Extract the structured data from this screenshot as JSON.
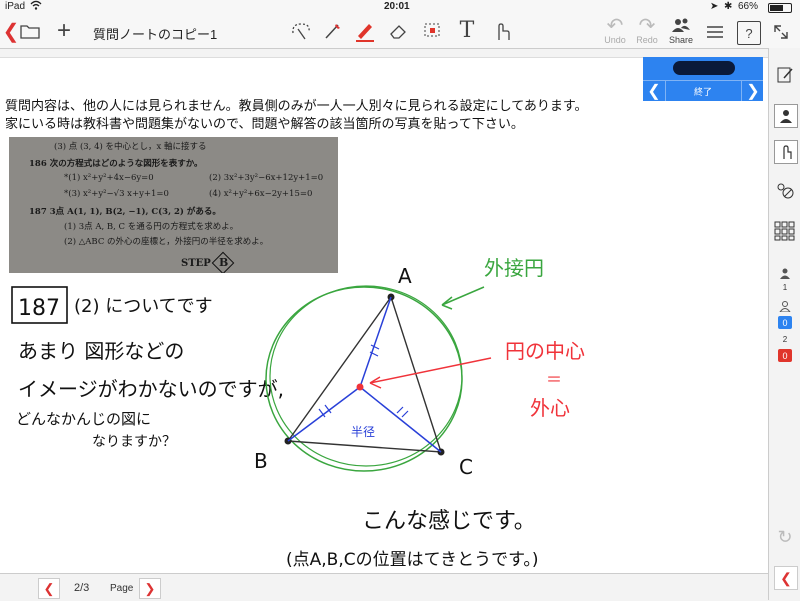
{
  "status_bar": {
    "device": "iPad",
    "time": "20:01",
    "battery": "66%"
  },
  "toolbar": {
    "title": "質問ノートのコピー1",
    "undo_label": "Undo",
    "redo_label": "Redo",
    "share_label": "Share",
    "help_label": "?"
  },
  "page": {
    "text_lines": [
      "質問内容は、他の人には見られません。教員側のみが一人一人別々に見られる設定にしてあります。",
      "家にいる時は教科書や問題集がないので、問題や解答の該当箇所の写真を貼って下さい。"
    ],
    "photo_lines": [
      "(3) 点 (3, 4) を中心とし，x 軸に接する",
      "186  次の方程式はどのような図形を表すか。",
      "*(1)  x²+y²+4x−6y=0",
      "(2)  3x²+3y²−6x+12y+1=0",
      "*(3)  x²+y²−√3 x+y+1=0",
      "(4)  x²+y²+6x−2y+15=0",
      "187  3点 A(1, 1), B(2, −1), C(3, 2) がある。",
      "(1)  3点 A, B, C を通る円の方程式を求めよ。",
      "(2)  △ABC の外心の座標と，外接円の半径を求めよ。",
      "STEP",
      "B"
    ],
    "handwriting": {
      "question_number": "187",
      "question_lines": [
        "(2) についてです",
        "あまり 図形などの",
        "イメージがわかないのですが,",
        "どんなかんじの図に",
        "なりますか？"
      ],
      "label_outer_circle": "外接円",
      "label_center_line1": "円の中心",
      "label_equals": "＝",
      "label_center_line2": "外心",
      "label_radius": "半径",
      "vertex_a": "A",
      "vertex_b": "B",
      "vertex_c": "C",
      "closing_line1": "こんな感じです。",
      "closing_line2": "(点A,B,Cの位置はてきとうです。)"
    }
  },
  "blue_panel": {
    "end_label": "終了"
  },
  "sidebar": {
    "count_1": "1",
    "badge_1": "0",
    "count_2": "2",
    "badge_2": "0"
  },
  "bottom_bar": {
    "page_number": "2/3",
    "page_label": "Page"
  },
  "colors": {
    "accent_red": "#e0352b",
    "blue_panel": "#2d83f0",
    "pen_green": "#3aa63f",
    "pen_blue": "#2940d8",
    "pen_red": "#f0333a"
  }
}
